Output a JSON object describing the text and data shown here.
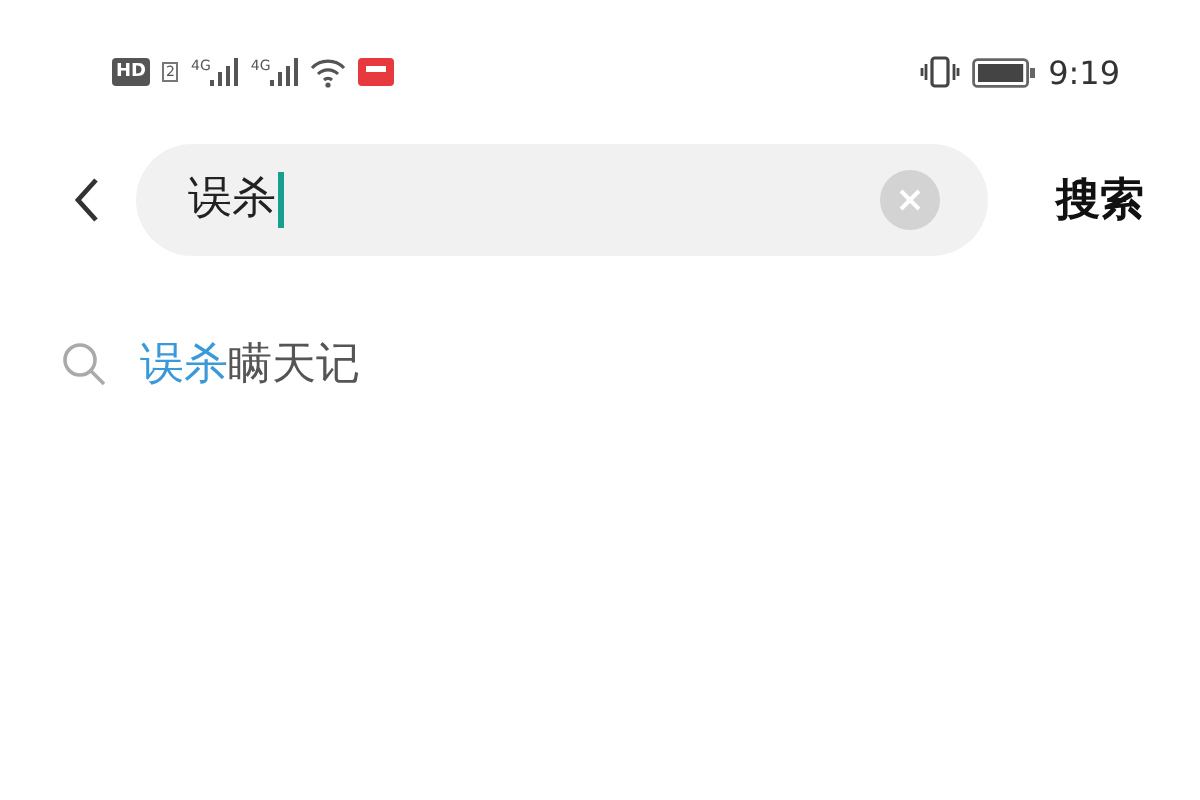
{
  "status_bar": {
    "hd": "HD",
    "sim": "2",
    "network_labels": [
      "4G",
      "4G"
    ],
    "time": "9:19"
  },
  "search": {
    "value": "误杀",
    "action": "搜索"
  },
  "suggestions": [
    {
      "match": "误杀",
      "rest": "瞒天记"
    }
  ]
}
